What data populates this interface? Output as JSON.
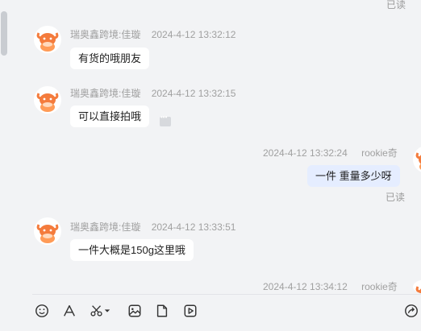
{
  "chat": {
    "read_top": "已读",
    "messages": [
      {
        "sender": "瑞奥鑫跨境:佳璇",
        "time": "2024-4-12 13:32:12",
        "text": "有货的哦朋友"
      },
      {
        "sender": "瑞奥鑫跨境:佳璇",
        "time": "2024-4-12 13:32:15",
        "text": "可以直接拍哦"
      },
      {
        "sender": "rookie奇",
        "time": "2024-4-12 13:32:24",
        "text": "一件  重量多少呀",
        "status": "已读"
      },
      {
        "sender": "瑞奥鑫跨境:佳璇",
        "time": "2024-4-12 13:33:51",
        "text": "一件大概是150g这里哦"
      },
      {
        "sender": "rookie奇",
        "time": "2024-4-12 13:34:12"
      }
    ]
  },
  "colors": {
    "avatar_orange": "#f47b3c",
    "bubble_mine": "#e5edff",
    "bubble_other": "#ffffff"
  },
  "toolbar": {
    "icons": [
      "emoji-icon",
      "font-icon",
      "scissors-icon",
      "image-icon",
      "file-icon",
      "video-icon",
      "send-icon"
    ]
  }
}
